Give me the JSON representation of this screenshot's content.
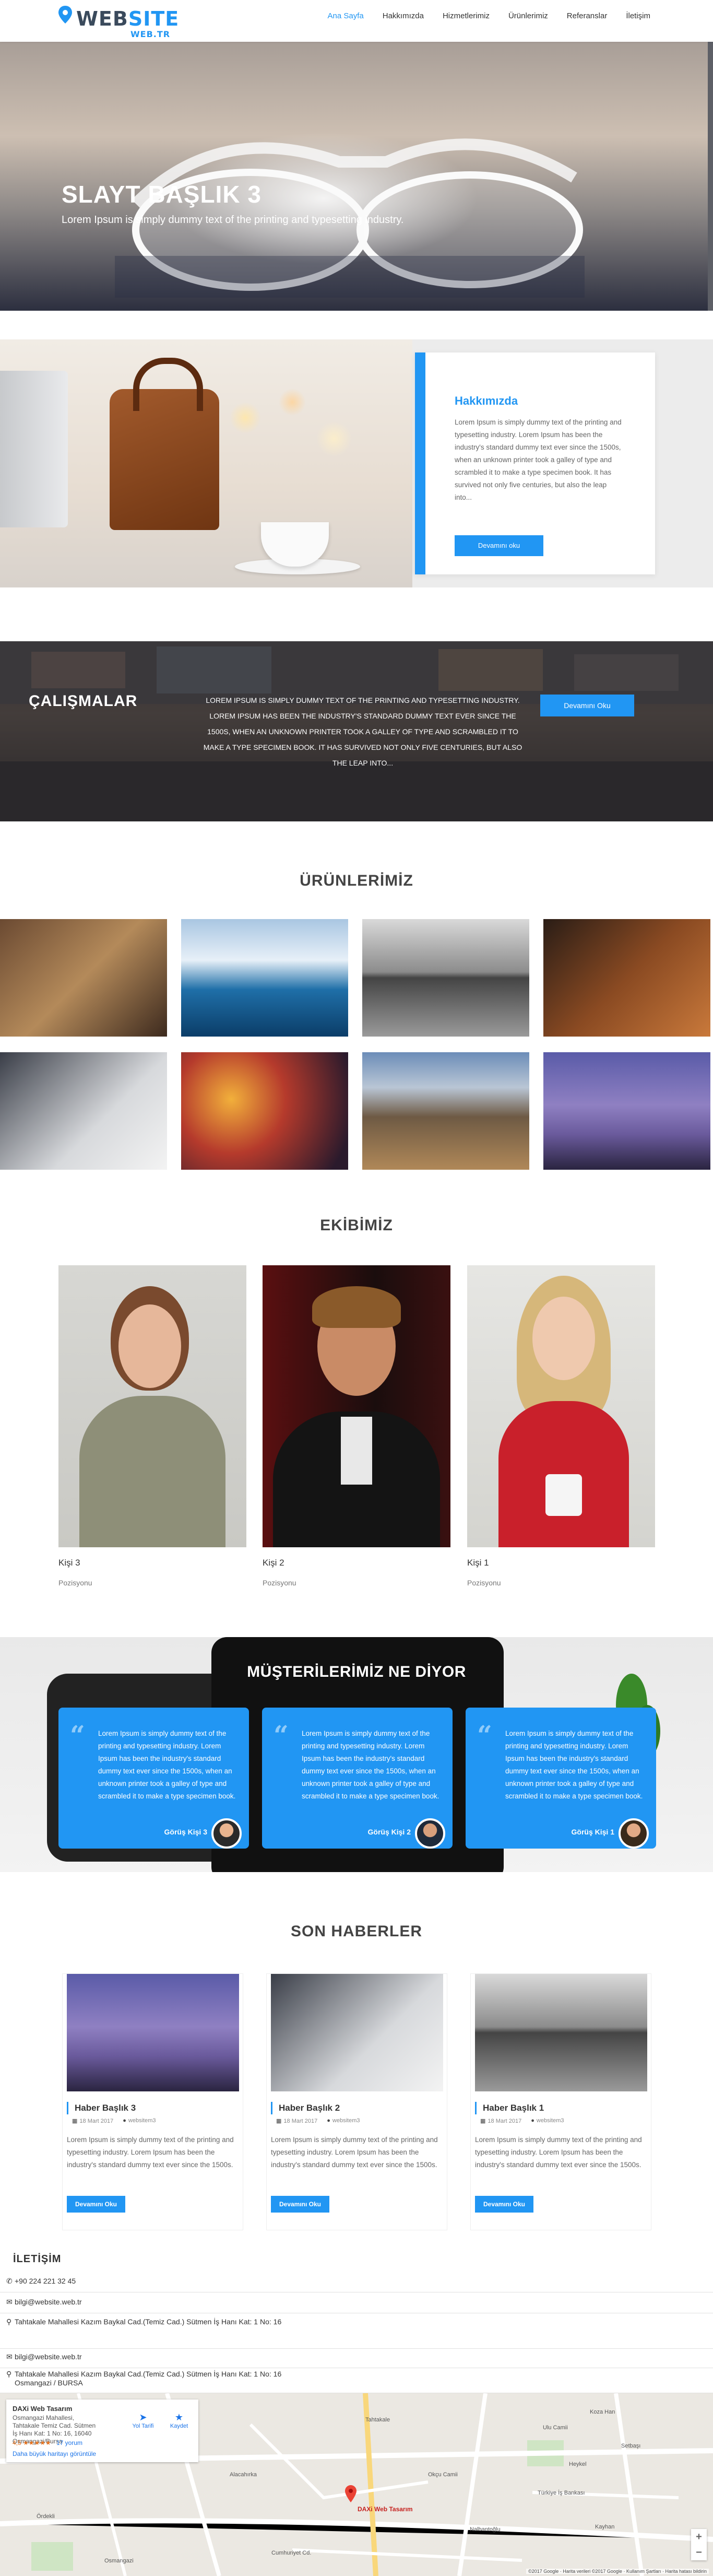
{
  "brand": {
    "name_dark": "WEB",
    "name_accent": "SITE",
    "sub": "WEB.TR"
  },
  "nav": [
    "Ana Sayfa",
    "Hakkımızda",
    "Hizmetlerimiz",
    "Ürünlerimiz",
    "Referanslar",
    "İletişim"
  ],
  "hero": {
    "title": "SLAYT BAŞLIK 3",
    "subtitle": "Lorem Ipsum is simply dummy text of the printing and typesetting industry."
  },
  "about": {
    "title": "Hakkımızda",
    "text": "Lorem Ipsum is simply dummy text of the printing and typesetting industry. Lorem Ipsum has been the industry's standard dummy text ever since the 1500s, when an unknown printer took a galley of type and scrambled it to make a type specimen book. It has survived not only five centuries, but also the leap into...",
    "button": "Devamını oku"
  },
  "works": {
    "title": "ÇALIŞMALAR",
    "text": "LOREM IPSUM IS SIMPLY DUMMY TEXT OF THE PRINTING AND TYPESETTING INDUSTRY. LOREM IPSUM HAS BEEN THE INDUSTRY'S STANDARD DUMMY TEXT EVER SINCE THE 1500S, WHEN AN UNKNOWN PRINTER TOOK A GALLEY OF TYPE AND SCRAMBLED IT TO MAKE A TYPE SPECIMEN BOOK. IT HAS SURVIVED NOT ONLY FIVE CENTURIES, BUT ALSO THE LEAP INTO...",
    "button": "Devamını Oku"
  },
  "products": {
    "title": "ÜRÜNLERİMİZ"
  },
  "team": {
    "title": "EKİBİMİZ",
    "members": [
      {
        "name": "Kişi 3",
        "role": "Pozisyonu"
      },
      {
        "name": "Kişi 2",
        "role": "Pozisyonu"
      },
      {
        "name": "Kişi 1",
        "role": "Pozisyonu"
      }
    ]
  },
  "testimonials": {
    "title": "MÜŞTERİLERİMİZ NE DİYOR",
    "items": [
      {
        "text": "Lorem Ipsum is simply dummy text of the printing and typesetting industry. Lorem Ipsum has been the industry's standard dummy text ever since the 1500s, when an unknown printer took a galley of type and scrambled it to make a type specimen book.",
        "author": "Görüş Kişi 3"
      },
      {
        "text": "Lorem Ipsum is simply dummy text of the printing and typesetting industry. Lorem Ipsum has been the industry's standard dummy text ever since the 1500s, when an unknown printer took a galley of type and scrambled it to make a type specimen book.",
        "author": "Görüş Kişi 2"
      },
      {
        "text": "Lorem Ipsum is simply dummy text of the printing and typesetting industry. Lorem Ipsum has been the industry's standard dummy text ever since the 1500s, when an unknown printer took a galley of type and scrambled it to make a type specimen book.",
        "author": "Görüş Kişi 1"
      }
    ]
  },
  "news": {
    "title": "SON HABERLER",
    "items": [
      {
        "title": "Haber Başlık 3",
        "date": "18 Mart 2017",
        "author": "websitem3",
        "text": "Lorem Ipsum is simply dummy text of the printing and typesetting industry. Lorem Ipsum has been the industry's standard dummy text ever since the 1500s.",
        "button": "Devamını Oku"
      },
      {
        "title": "Haber Başlık 2",
        "date": "18 Mart 2017",
        "author": "websitem3",
        "text": "Lorem Ipsum is simply dummy text of the printing and typesetting industry. Lorem Ipsum has been the industry's standard dummy text ever since the 1500s.",
        "button": "Devamını Oku"
      },
      {
        "title": "Haber Başlık 1",
        "date": "18 Mart 2017",
        "author": "websitem3",
        "text": "Lorem Ipsum is simply dummy text of the printing and typesetting industry. Lorem Ipsum has been the industry's standard dummy text ever since the 1500s.",
        "button": "Devamını Oku"
      }
    ]
  },
  "contact": {
    "title": "İLETİŞİM",
    "phone": "+90 224 221 32 45",
    "email1": "bilgi@website.web.tr",
    "address1": "Tahtakale Mahallesi Kazım Baykal Cad.(Temiz Cad.) Sütmen İş Hanı Kat: 1 No: 16",
    "email2": "bilgi@website.web.tr",
    "address2": "Tahtakale Mahallesi Kazım Baykal Cad.(Temiz Cad.) Sütmen İş Hanı Kat: 1 No: 16",
    "address2_city": "Osmangazi / BURSA"
  },
  "map": {
    "place": "DAXi Web Tasarım",
    "address": "Osmangazi Mahallesi, Tahtakale Temiz Cad. Sütmen İş Hanı Kat: 1 No: 16, 16040 Osmangazi/Bursa",
    "rating": "4,5 ★★★★★",
    "reviews": "17 yorum",
    "bigger_map": "Daha büyük haritayı görüntüle",
    "directions": "Yol Tarifi",
    "save": "Kaydet",
    "pin_label": "DAXi Web Tasarım",
    "credit": "©2017 Google · Harita verileri ©2017 Google · Kullanım Şartları · Harita hatası bildirin",
    "labels": [
      "Tahtakale",
      "Okçu Camii",
      "Ulu Camii",
      "Koza Han",
      "Cumhuriyet Cd.",
      "Türkiye İş Bankası",
      "Kayhan",
      "Osmangazi",
      "Alacahırka",
      "Setbaşı",
      "Ördekli",
      "Nalbantoğlu",
      "Heykel"
    ]
  }
}
